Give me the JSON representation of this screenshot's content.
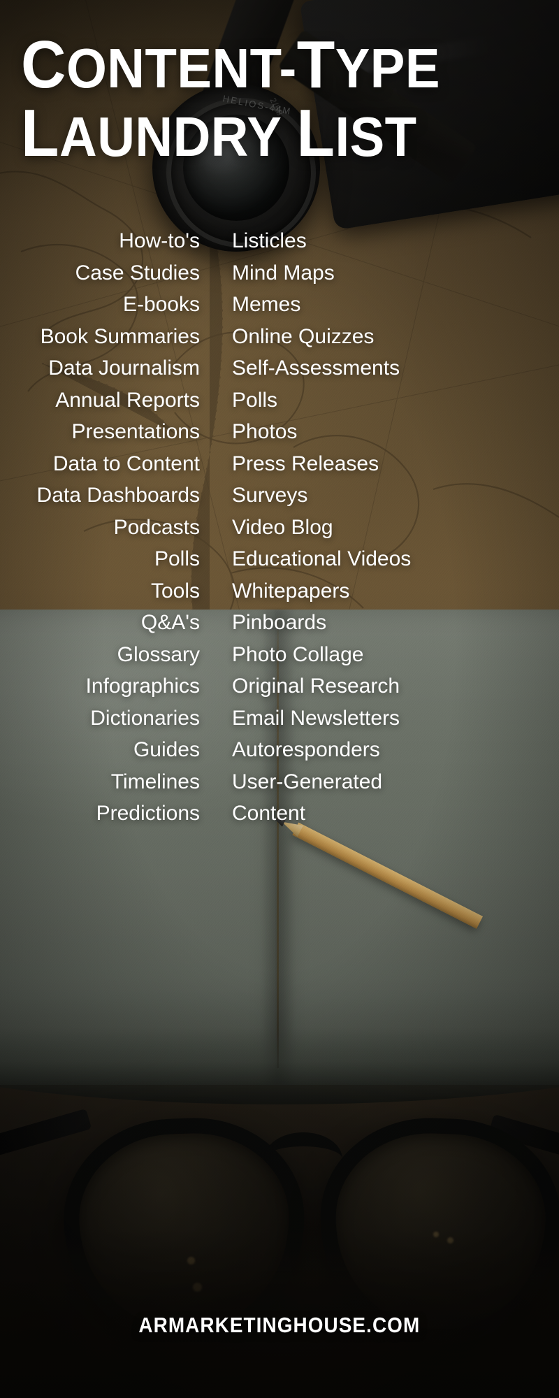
{
  "poster": {
    "title_line_1": "Content-type",
    "title_line_2": "Laundry List",
    "footer": "ARMARKETINGHOUSE.COM",
    "background_scene": "vintage-map-camera-open-book-eyeglasses",
    "colors": {
      "text": "#ffffff",
      "map_background": "#6e5938",
      "book_page": "#767d72",
      "dark_bottom": "#0d0b08"
    },
    "photo_details": {
      "lens_engraving": "HELIOS-44M",
      "lens_aperture": "2/58"
    }
  },
  "list": {
    "left_column": [
      "How-to's",
      "Case Studies",
      "E-books",
      "Book Summaries",
      "Data Journalism",
      "Annual Reports",
      "Presentations",
      "Data to Content",
      "Data Dashboards",
      "Podcasts",
      "Polls",
      "Tools",
      "Q&A's",
      "Glossary",
      "Infographics",
      "Dictionaries",
      "Guides",
      "Timelines",
      "Predictions"
    ],
    "right_column": [
      "Listicles",
      "Mind Maps",
      "Memes",
      "Online Quizzes",
      "Self-Assessments",
      "Polls",
      "Photos",
      "Press Releases",
      "Surveys",
      "Video Blog",
      "Educational Videos",
      "Whitepapers",
      "Pinboards",
      "Photo Collage",
      "Original Research",
      "Email Newsletters",
      "Autoresponders",
      "User-Generated",
      "Content"
    ]
  }
}
